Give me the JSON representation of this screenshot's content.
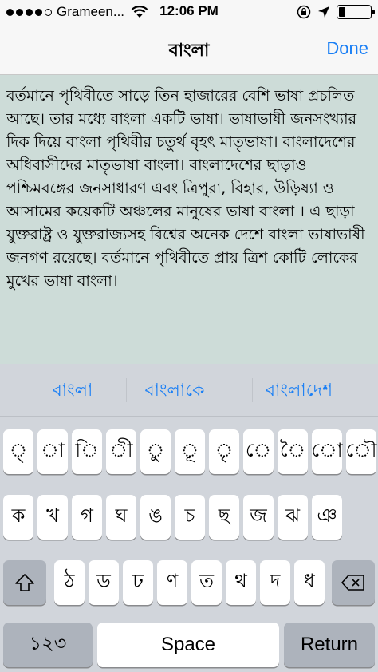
{
  "status": {
    "carrier": "Grameen...",
    "time": "12:06 PM",
    "signal_dots_filled": 4,
    "signal_dots_total": 5,
    "battery_level": 0.2
  },
  "nav": {
    "title": "বাংলা",
    "done_label": "Done"
  },
  "text_area": {
    "content": "বর্তমানে পৃথিবীতে সাড়ে তিন হাজারের বেশি ভাষা প্রচলিত আছে। তার মধ্যে বাংলা একটি ভাষা। ভাষাভাষী জনসংখ্যার দিক দিয়ে বাংলা পৃথিবীর চতুর্থ বৃহৎ মাতৃভাষা। বাংলাদেশের অধিবাসীদের মাতৃভাষা বাংলা। বাংলাদেশের ছাড়াও পশ্চিমবঙ্গের জনসাধারণ এবং ত্রিপুরা, বিহার, উড়িষ্যা ও আসামের কয়েকটি অঞ্চলের মানুষের ভাষা বাংলা । এ ছাড়া যুক্তরাষ্ট্র ও যুক্তরাজ্যসহ বিশ্বের অনেক দেশে বাংলা ভাষাভাষী জনগণ রয়েছে। বর্তমানে পৃথিবীতে প্রায় ত্রিশ কোটি লোকের মুখের ভাষা বাংলা।"
  },
  "suggestions": [
    "বাংলা",
    "বাংলাকে",
    "বাংলাদেশ"
  ],
  "keyboard": {
    "row1": [
      "্",
      "া",
      "ি",
      "ী",
      "ু",
      "ূ",
      "ৃ",
      "ে",
      "ৈ",
      "ো",
      "ৌ"
    ],
    "row2": [
      "ক",
      "খ",
      "গ",
      "ঘ",
      "ঙ",
      "চ",
      "ছ",
      "জ",
      "ঝ",
      "ঞ"
    ],
    "row3": [
      "ঠ",
      "ড",
      "ঢ",
      "ণ",
      "ত",
      "থ",
      "দ",
      "ধ"
    ],
    "shift_icon": "shift-arrow-icon",
    "backspace_icon": "backspace-icon",
    "numbers_label": "১২৩",
    "space_label": "Space",
    "return_label": "Return"
  }
}
